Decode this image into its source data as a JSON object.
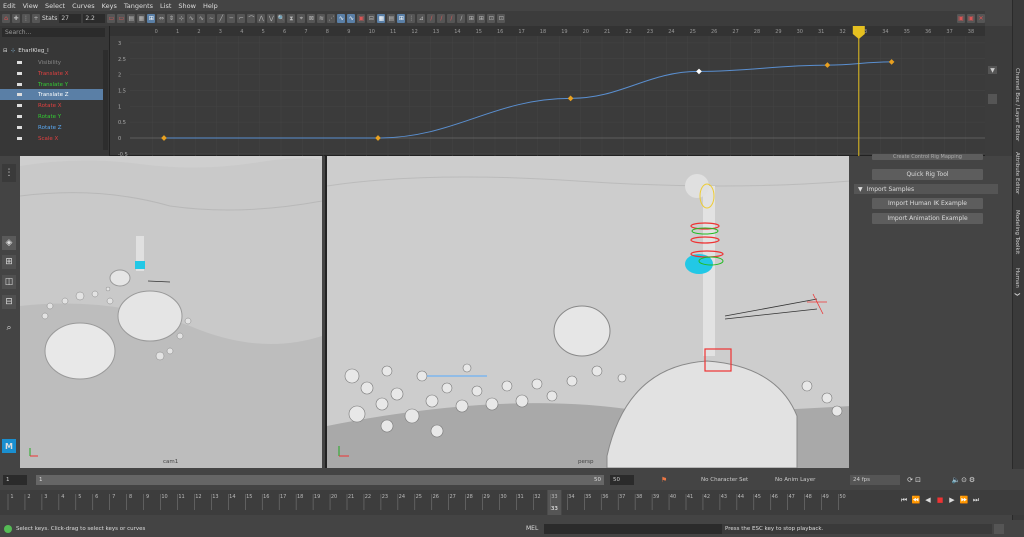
{
  "menu": [
    "Edit",
    "View",
    "Select",
    "Curves",
    "Keys",
    "Tangents",
    "List",
    "Show",
    "Help"
  ],
  "toolbar": {
    "stats_label": "Stats",
    "frame_value": "27",
    "value_field": "2.2"
  },
  "outliner": {
    "search_placeholder": "Search...",
    "root": "EharlKleg_l",
    "items": [
      "Visibility",
      "Translate X",
      "Translate Y",
      "Translate Z",
      "Rotate X",
      "Rotate Y",
      "Rotate Z",
      "Scale X"
    ]
  },
  "graph": {
    "frame_ticks": [
      "0",
      "1",
      "2",
      "3",
      "4",
      "5",
      "6",
      "7",
      "8",
      "9",
      "10",
      "11",
      "12",
      "13",
      "14",
      "15",
      "16",
      "17",
      "18",
      "19",
      "20",
      "21",
      "22",
      "23",
      "24",
      "25",
      "26",
      "27",
      "28",
      "29",
      "30",
      "31",
      "32",
      "33",
      "34",
      "35",
      "36",
      "37",
      "38"
    ],
    "value_ticks": [
      "3",
      "2.5",
      "2",
      "1.5",
      "1",
      "0.5",
      "0",
      "-0.5"
    ],
    "current_frame": "33",
    "curve_key_frames": [
      0,
      10,
      19,
      25,
      31,
      34
    ],
    "curve_key_values": [
      0,
      0,
      1.25,
      2.1,
      2.3,
      2.4
    ]
  },
  "viewports": [
    {
      "label": "cam1"
    },
    {
      "label": "persp"
    }
  ],
  "right_panel": {
    "clipped_label": "Create Control Rig Mapping",
    "quick_rig": "Quick Rig Tool",
    "import_samples": "Import Samples",
    "import_hik": "Import Human IK Example",
    "import_anim": "Import Animation Example"
  },
  "side_tabs": [
    "Channel Box / Layer Editor",
    "Attribute Editor",
    "Modeling Toolkit",
    "Human"
  ],
  "range": {
    "start": "1",
    "inner_start": "1",
    "inner_end": "50",
    "end": "50",
    "character_set": "No Character Set",
    "anim_layer": "No Anim Layer",
    "fps": "24 fps"
  },
  "timeline": {
    "ticks": [
      "1",
      "2",
      "3",
      "4",
      "5",
      "6",
      "7",
      "8",
      "9",
      "10",
      "11",
      "12",
      "13",
      "14",
      "15",
      "16",
      "17",
      "18",
      "19",
      "20",
      "21",
      "22",
      "23",
      "24",
      "25",
      "26",
      "27",
      "28",
      "29",
      "30",
      "31",
      "32",
      "33",
      "34",
      "35",
      "36",
      "37",
      "38",
      "39",
      "40",
      "41",
      "42",
      "43",
      "44",
      "45",
      "46",
      "47",
      "48",
      "49",
      "50"
    ],
    "current": "33"
  },
  "status": {
    "left": "Select keys. Click-drag to select keys or curves",
    "mel": "MEL",
    "right": "Press the ESC key to stop playback."
  }
}
